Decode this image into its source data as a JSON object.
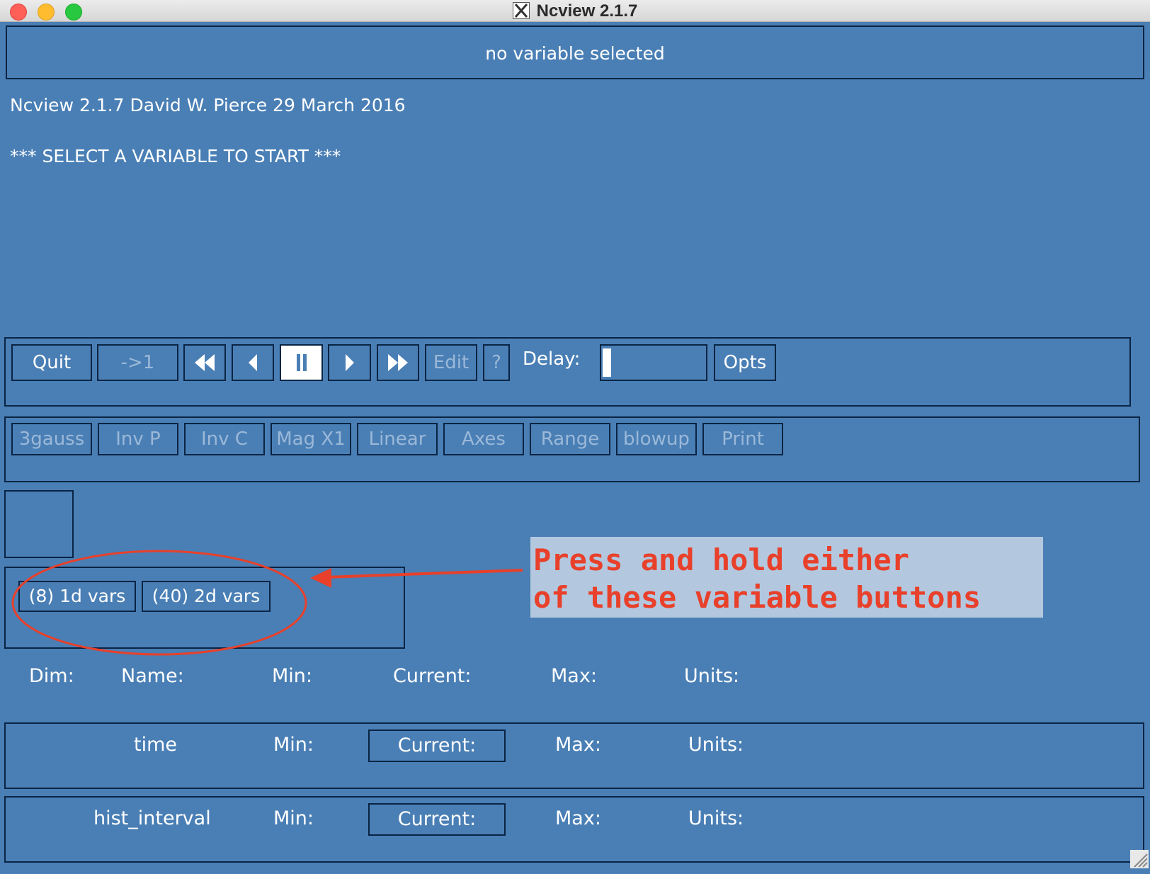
{
  "window": {
    "title": "Ncview 2.1.7"
  },
  "header": {
    "status": "no variable selected"
  },
  "info": {
    "version_line": "Ncview 2.1.7 David W. Pierce  29 March 2016",
    "prompt": "*** SELECT A VARIABLE TO START ***"
  },
  "controls": {
    "quit": "Quit",
    "reset": "->1",
    "edit": "Edit",
    "help": "?",
    "delay_label": "Delay:",
    "opts": "Opts"
  },
  "tools": [
    "3gauss",
    "Inv P",
    "Inv C",
    "Mag X1",
    "Linear",
    "Axes",
    "Range",
    "blowup",
    "Print"
  ],
  "varsets": {
    "one": "(8) 1d vars",
    "two": "(40) 2d vars"
  },
  "annotation": {
    "line1": "Press and hold either",
    "line2": "of these variable buttons"
  },
  "dim_header": {
    "dim": "Dim:",
    "name": "Name:",
    "min": "Min:",
    "current": "Current:",
    "max": "Max:",
    "units": "Units:"
  },
  "dims": [
    {
      "name": "time",
      "min": "Min:",
      "current": "Current:",
      "max": "Max:",
      "units": "Units:"
    },
    {
      "name": "hist_interval",
      "min": "Min:",
      "current": "Current:",
      "max": "Max:",
      "units": "Units:"
    }
  ],
  "colors": {
    "background": "#4a7fb5",
    "border": "#0a2444",
    "annotation_text": "#e8402a",
    "annotation_bg": "#b3c8df"
  }
}
